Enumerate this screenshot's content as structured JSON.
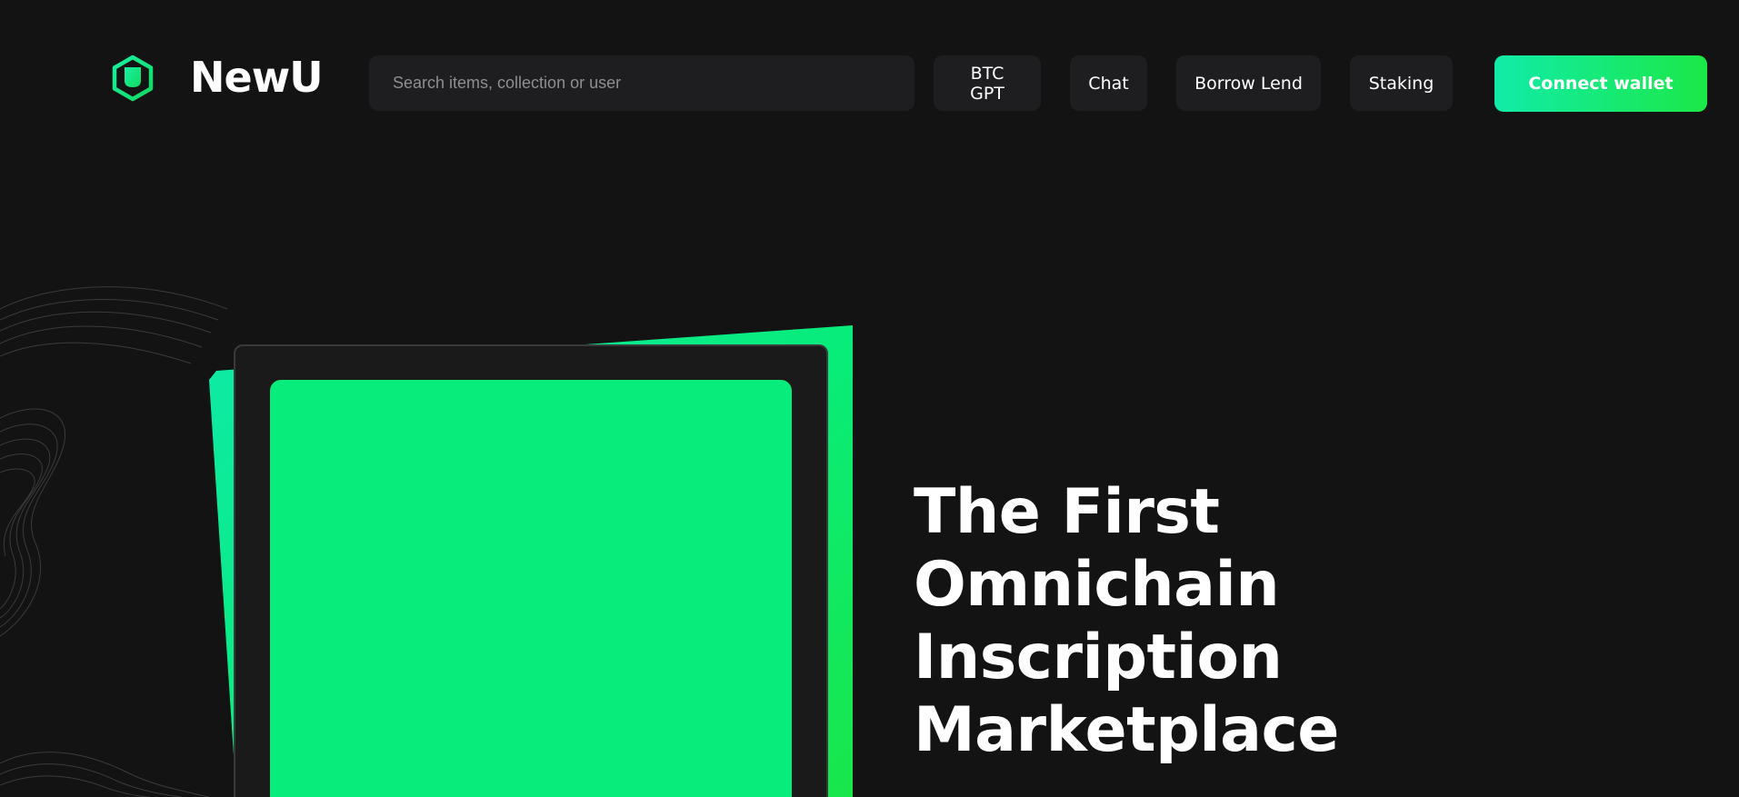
{
  "header": {
    "brand": "NewU",
    "logo_icon": "hexagon-u-logo-icon",
    "search": {
      "placeholder": "Search items, collection or user",
      "value": ""
    },
    "nav": {
      "btc_gpt_line1": "BTC",
      "btc_gpt_line2": "GPT",
      "chat": "Chat",
      "borrow_lend": "Borrow Lend",
      "staking": "Staking"
    },
    "connect_wallet": "Connect wallet"
  },
  "hero": {
    "title_lines": [
      "The First",
      "Omnichain",
      "Inscription",
      "Marketplace"
    ]
  },
  "colors": {
    "background": "#131314",
    "accent_green": "#08ec7c",
    "accent_teal": "#11eba9",
    "button_surface": "#1e1e20"
  }
}
